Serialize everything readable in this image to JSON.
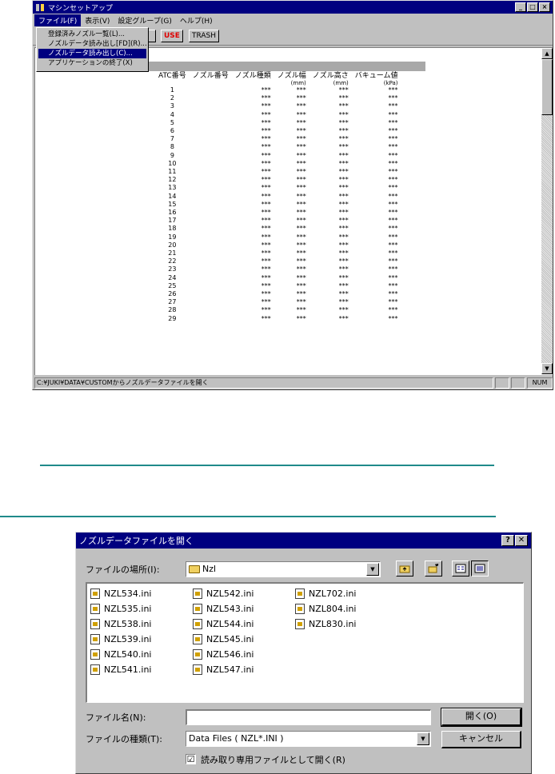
{
  "main_window": {
    "title": "マシンセットアップ",
    "menu": [
      "ファイル(F)",
      "表示(V)",
      "設定グループ(G)",
      "ヘルプ(H)"
    ],
    "file_menu_items": [
      "登録済みノズル一覧(L)...",
      "ノズルデータ読み出し[FD](R)...",
      "ノズルデータ読み出し(C)...",
      "アプリケーションの終了(X)"
    ],
    "toolbar": {
      "use_label": "USE",
      "trash_label": "TRASH"
    },
    "table": {
      "headers": [
        {
          "label": "ATC番号",
          "unit": ""
        },
        {
          "label": "ノズル番号",
          "unit": ""
        },
        {
          "label": "ノズル種類",
          "unit": ""
        },
        {
          "label": "ノズル幅",
          "unit": "(mm)"
        },
        {
          "label": "ノズル高さ",
          "unit": "(mm)"
        },
        {
          "label": "バキューム値",
          "unit": "(kPa)"
        }
      ],
      "cell_placeholder": "***",
      "rows": [
        "1",
        "2",
        "3",
        "4",
        "5",
        "6",
        "7",
        "8",
        "9",
        "10",
        "11",
        "12",
        "13",
        "14",
        "15",
        "16",
        "17",
        "18",
        "19",
        "20",
        "21",
        "22",
        "23",
        "24",
        "25",
        "26",
        "27",
        "28",
        "29"
      ]
    },
    "status": {
      "message": "C:¥JUKI¥DATA¥CUSTOMからノズルデータファイルを開く",
      "num": "NUM"
    }
  },
  "dialog": {
    "title": "ノズルデータファイルを開く",
    "help_label": "?",
    "close_label": "✕",
    "location_label": "ファイルの場所(I):",
    "location_value": "Nzl",
    "files": [
      [
        "NZL534.ini",
        "NZL535.ini",
        "NZL538.ini",
        "NZL539.ini",
        "NZL540.ini",
        "NZL541.ini"
      ],
      [
        "NZL542.ini",
        "NZL543.ini",
        "NZL544.ini",
        "NZL545.ini",
        "NZL546.ini",
        "NZL547.ini"
      ],
      [
        "NZL702.ini",
        "NZL804.ini",
        "NZL830.ini"
      ]
    ],
    "filename_label": "ファイル名(N):",
    "filename_value": "",
    "filetype_label": "ファイルの種類(T):",
    "filetype_value": "Data Files ( NZL*.INI )",
    "open_button": "開く(O)",
    "cancel_button": "キャンセル",
    "readonly_label": "読み取り専用ファイルとして開く(R)",
    "readonly_checked": "☑"
  }
}
